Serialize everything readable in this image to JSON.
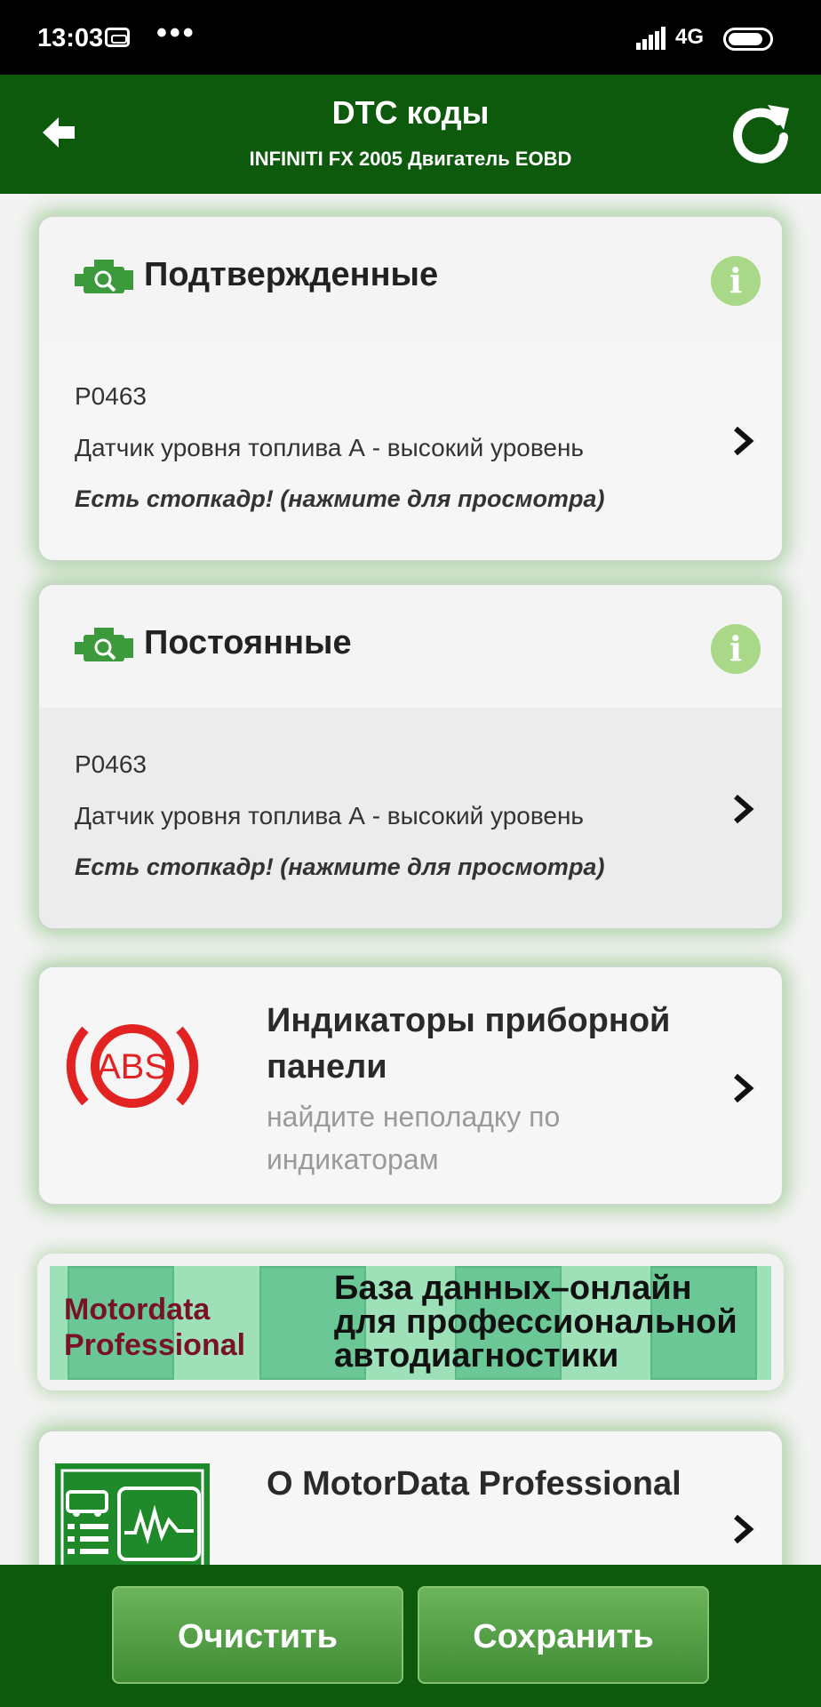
{
  "status_bar": {
    "time": "13:03",
    "dots": "•••",
    "network": "4G"
  },
  "header": {
    "title": "DTC коды",
    "subtitle": "INFINITI FX 2005 Двигатель EOBD"
  },
  "sections": [
    {
      "title": "Подтвержденные",
      "code": "P0463",
      "description": "Датчик уровня топлива А - высокий уровень",
      "freeze_frame": "Есть стопкадр! (нажмите для просмотра)"
    },
    {
      "title": "Постоянные",
      "code": "P0463",
      "description": "Датчик уровня топлива А - высокий уровень",
      "freeze_frame": "Есть стопкадр! (нажмите для просмотра)"
    }
  ],
  "indicators": {
    "title": "Индикаторы приборной панели",
    "subtitle": "найдите неполадку по индикаторам",
    "icon_text": "ABS"
  },
  "banner": {
    "brand_line1": "Motordata",
    "brand_line2": "Professional",
    "tagline_line1": "База данных–онлайн",
    "tagline_line2": "для профессиональной",
    "tagline_line3": "автодиагностики"
  },
  "about": {
    "title": "О MotorData Professional"
  },
  "buttons": {
    "clear": "Очистить",
    "save": "Сохранить"
  },
  "colors": {
    "primary": "#0d5a0d",
    "accent": "#5aaa46",
    "info": "#a8d888",
    "abs_red": "#e32222"
  }
}
